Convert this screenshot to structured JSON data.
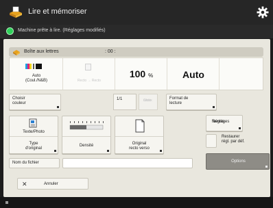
{
  "header": {
    "title": "Lire et mémoriser"
  },
  "status": {
    "text": "Machine prête à lire. (Réglages modifiés)"
  },
  "mailbox": {
    "label": "Boîte aux lettres",
    "count": ": 00 :"
  },
  "summary": {
    "color": {
      "line1": "Auto",
      "line2": "(Coul./N&B)"
    },
    "sided": {
      "text": "Recto → Recto"
    },
    "zoom": {
      "value": "100",
      "unit": "%"
    },
    "size": {
      "value": "Auto"
    }
  },
  "buttons": {
    "color_select": {
      "line1": "Choisir",
      "line2": "couleur"
    },
    "page": "1/1",
    "page_btn": {
      "line1": "Choix",
      "line2": "recto"
    },
    "scan_size": {
      "line1": "Format de",
      "line2": "lecture"
    },
    "orig_type": {
      "value": "Texte/Photo",
      "line1": "Type",
      "line2": "d'original"
    },
    "density": {
      "label": "Densité"
    },
    "orig_content": {
      "line1": "Original",
      "line2": "recto verso"
    },
    "favorites": {
      "line1": "Réglages",
      "line2": "favoris"
    },
    "reset": {
      "line1": "Restaurer",
      "line2": "régl. par déf."
    },
    "options": "Options",
    "file_name": "Nom du fichier",
    "cancel": "Annuler"
  },
  "file_name_value": "",
  "colors": {
    "accent": "#f0b429",
    "status_green": "#2fd15a",
    "panel": "#e9e7de"
  },
  "icons": [
    "scan-store-app-icon",
    "gear-icon",
    "status-ok-icon",
    "mailbox-icon",
    "color-mode-icon",
    "document-type-icon",
    "density-slider-icon",
    "original-page-icon",
    "close-icon"
  ]
}
